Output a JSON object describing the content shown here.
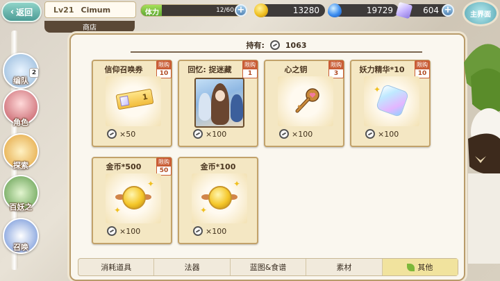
{
  "header": {
    "back_label": "返回",
    "level": "Lv21",
    "player_name": "Cimum",
    "section_tab": "商店",
    "stamina_label": "体力",
    "stamina_value": "12/60",
    "stamina_fraction": 0.2,
    "gold": "13280",
    "gems": "19729",
    "crystals": "604",
    "home_label": "主界面"
  },
  "sidebar": {
    "items": [
      {
        "label": "编队",
        "badge": "2"
      },
      {
        "label": "角色"
      },
      {
        "label": "探索"
      },
      {
        "label": "百妖之"
      },
      {
        "label": "召唤"
      }
    ]
  },
  "shop": {
    "holdings_label": "持有:",
    "holdings_value": "1063",
    "limit_text": "限购",
    "items": [
      {
        "name": "信仰召唤券",
        "limit": "10",
        "price": "×50",
        "icon": "summon-ticket-icon",
        "ticket_num": "1"
      },
      {
        "name": "回忆: 捉迷藏",
        "limit": "1",
        "price": "×100",
        "icon": "memory-card-art"
      },
      {
        "name": "心之钥",
        "limit": "3",
        "price": "×100",
        "icon": "heart-key-icon"
      },
      {
        "name": "妖力精华*10",
        "limit": "10",
        "price": "×100",
        "icon": "essence-crystal-icon"
      },
      {
        "name": "金币*500",
        "limit": "50",
        "price": "×100",
        "icon": "gold-coin-icon"
      },
      {
        "name": "金币*100",
        "limit": null,
        "price": "×100",
        "icon": "gold-coin-icon"
      }
    ]
  },
  "tabs": [
    {
      "label": "消耗道具",
      "active": false
    },
    {
      "label": "法器",
      "active": false
    },
    {
      "label": "蓝图&食谱",
      "active": false
    },
    {
      "label": "素材",
      "active": false
    },
    {
      "label": "其他",
      "active": true
    }
  ],
  "colors": {
    "accent_teal": "#4c9c96",
    "limit_red": "#c95d36",
    "card_bg": "#f4e7c3",
    "active_tab": "#f1e39e"
  }
}
